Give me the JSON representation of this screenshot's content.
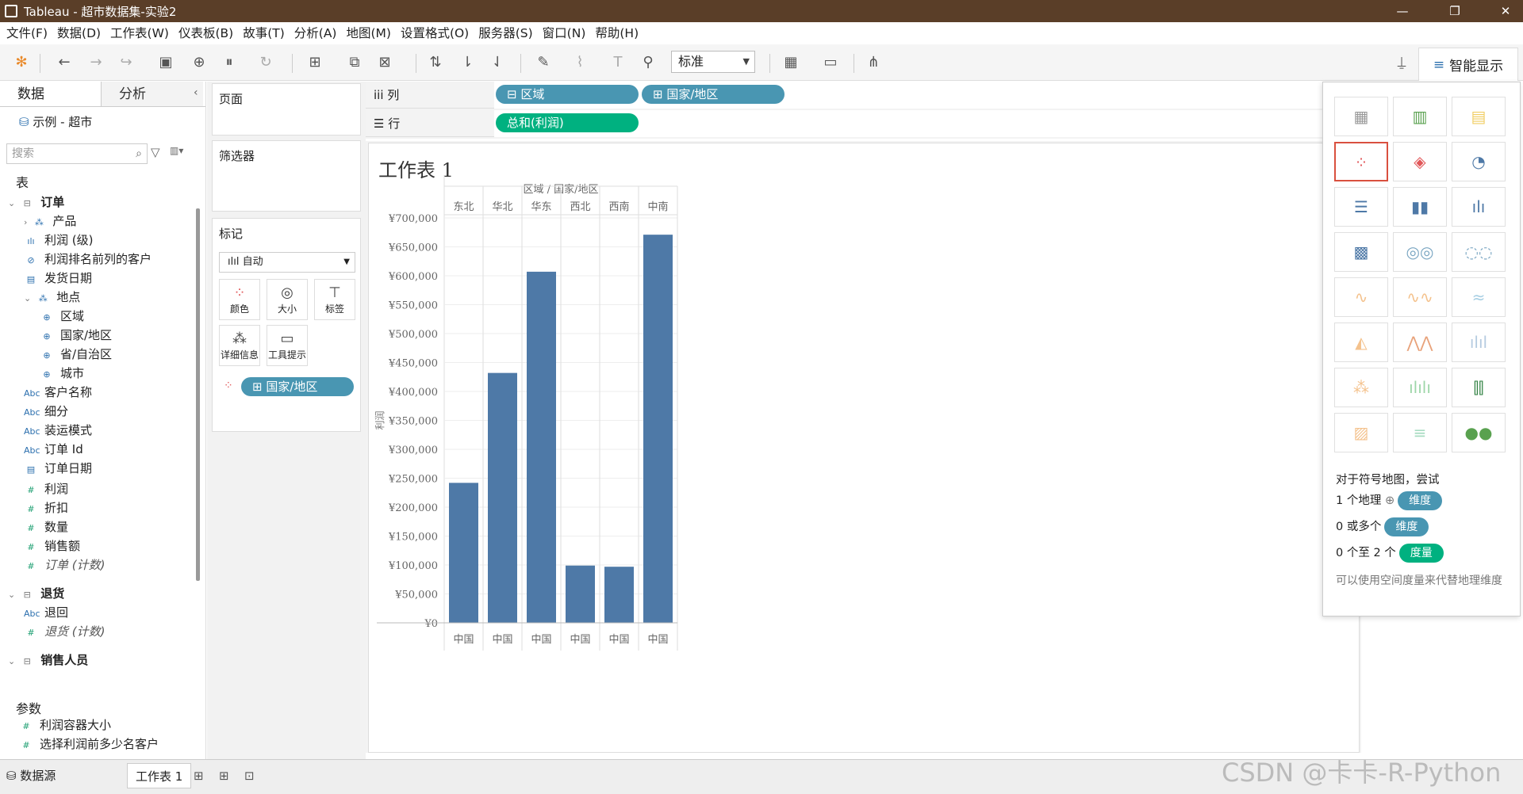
{
  "window": {
    "title": "Tableau - 超市数据集-实验2",
    "controls": {
      "minimize": "—",
      "maximize": "❐",
      "close": "✕"
    }
  },
  "menu": [
    "文件(F)",
    "数据(D)",
    "工作表(W)",
    "仪表板(B)",
    "故事(T)",
    "分析(A)",
    "地图(M)",
    "设置格式(O)",
    "服务器(S)",
    "窗口(N)",
    "帮助(H)"
  ],
  "toolbar": {
    "fit": "标准",
    "smart_show": "智能显示"
  },
  "left_panel": {
    "tabs": [
      "数据",
      "分析"
    ],
    "datasource": "示例 - 超市",
    "search_placeholder": "搜索",
    "section_table": "表",
    "section_params": "参数",
    "tree": [
      {
        "label": "订单",
        "type": "table"
      },
      {
        "label": "产品",
        "type": "hier"
      },
      {
        "label": "利润 (级)",
        "type": "bin"
      },
      {
        "label": "利润排名前列的客户",
        "type": "set"
      },
      {
        "label": "发货日期",
        "type": "date"
      },
      {
        "label": "地点",
        "type": "hier"
      },
      {
        "label": "区域",
        "type": "geo"
      },
      {
        "label": "国家/地区",
        "type": "geo"
      },
      {
        "label": "省/自治区",
        "type": "geo"
      },
      {
        "label": "城市",
        "type": "geo"
      },
      {
        "label": "客户名称",
        "type": "abc"
      },
      {
        "label": "细分",
        "type": "abc"
      },
      {
        "label": "装运模式",
        "type": "abc"
      },
      {
        "label": "订单 Id",
        "type": "abc"
      },
      {
        "label": "订单日期",
        "type": "date"
      },
      {
        "label": "利润",
        "type": "num"
      },
      {
        "label": "折扣",
        "type": "num"
      },
      {
        "label": "数量",
        "type": "num"
      },
      {
        "label": "销售额",
        "type": "num"
      },
      {
        "label": "订单 (计数)",
        "type": "num"
      },
      {
        "label": "退货",
        "type": "table"
      },
      {
        "label": "退回",
        "type": "abc"
      },
      {
        "label": "退货 (计数)",
        "type": "num"
      },
      {
        "label": "销售人员",
        "type": "table"
      }
    ],
    "params": [
      "利润容器大小",
      "选择利润前多少名客户"
    ]
  },
  "cards": {
    "pages": "页面",
    "filters": "筛选器",
    "marks": "标记",
    "mark_type": "自动",
    "mark_buttons": [
      "颜色",
      "大小",
      "标签",
      "详细信息",
      "工具提示"
    ],
    "mark_pill": "国家/地区"
  },
  "shelves": {
    "columns_label": "列",
    "rows_label": "行",
    "columns": [
      "区域",
      "国家/地区"
    ],
    "rows": [
      "总和(利润)"
    ]
  },
  "sheet_title": "工作表 1",
  "chart_data": {
    "type": "bar",
    "header": "区域 / 国家/地区",
    "categories": [
      "东北",
      "华北",
      "华东",
      "西北",
      "西南",
      "中南"
    ],
    "sub_categories": [
      "中国",
      "中国",
      "中国",
      "中国",
      "中国",
      "中国"
    ],
    "values": [
      242000,
      432000,
      607000,
      99000,
      97000,
      671000
    ],
    "ylabel": "利润",
    "ylim": [
      0,
      700000
    ],
    "yticks": [
      "¥0",
      "¥50,000",
      "¥100,000",
      "¥150,000",
      "¥200,000",
      "¥250,000",
      "¥300,000",
      "¥350,000",
      "¥400,000",
      "¥450,000",
      "¥500,000",
      "¥550,000",
      "¥600,000",
      "¥650,000",
      "¥700,000"
    ],
    "bar_color": "#4e79a7",
    "grid": true
  },
  "smart_show": {
    "hint_title": "对于符号地图，尝试",
    "rows": [
      {
        "prefix": "1 个地理",
        "badge": "维度",
        "color": "#4996b2"
      },
      {
        "prefix": "0 或多个",
        "badge": "维度",
        "color": "#4996b2"
      },
      {
        "prefix": "0 个至 2 个",
        "badge": "度量",
        "color": "#00b180"
      }
    ],
    "note": "可以使用空间度量来代替地理维度"
  },
  "bottom": {
    "datasource_tab": "数据源",
    "sheet_tab": "工作表 1"
  },
  "watermark": "CSDN @卡卡-R-Python"
}
